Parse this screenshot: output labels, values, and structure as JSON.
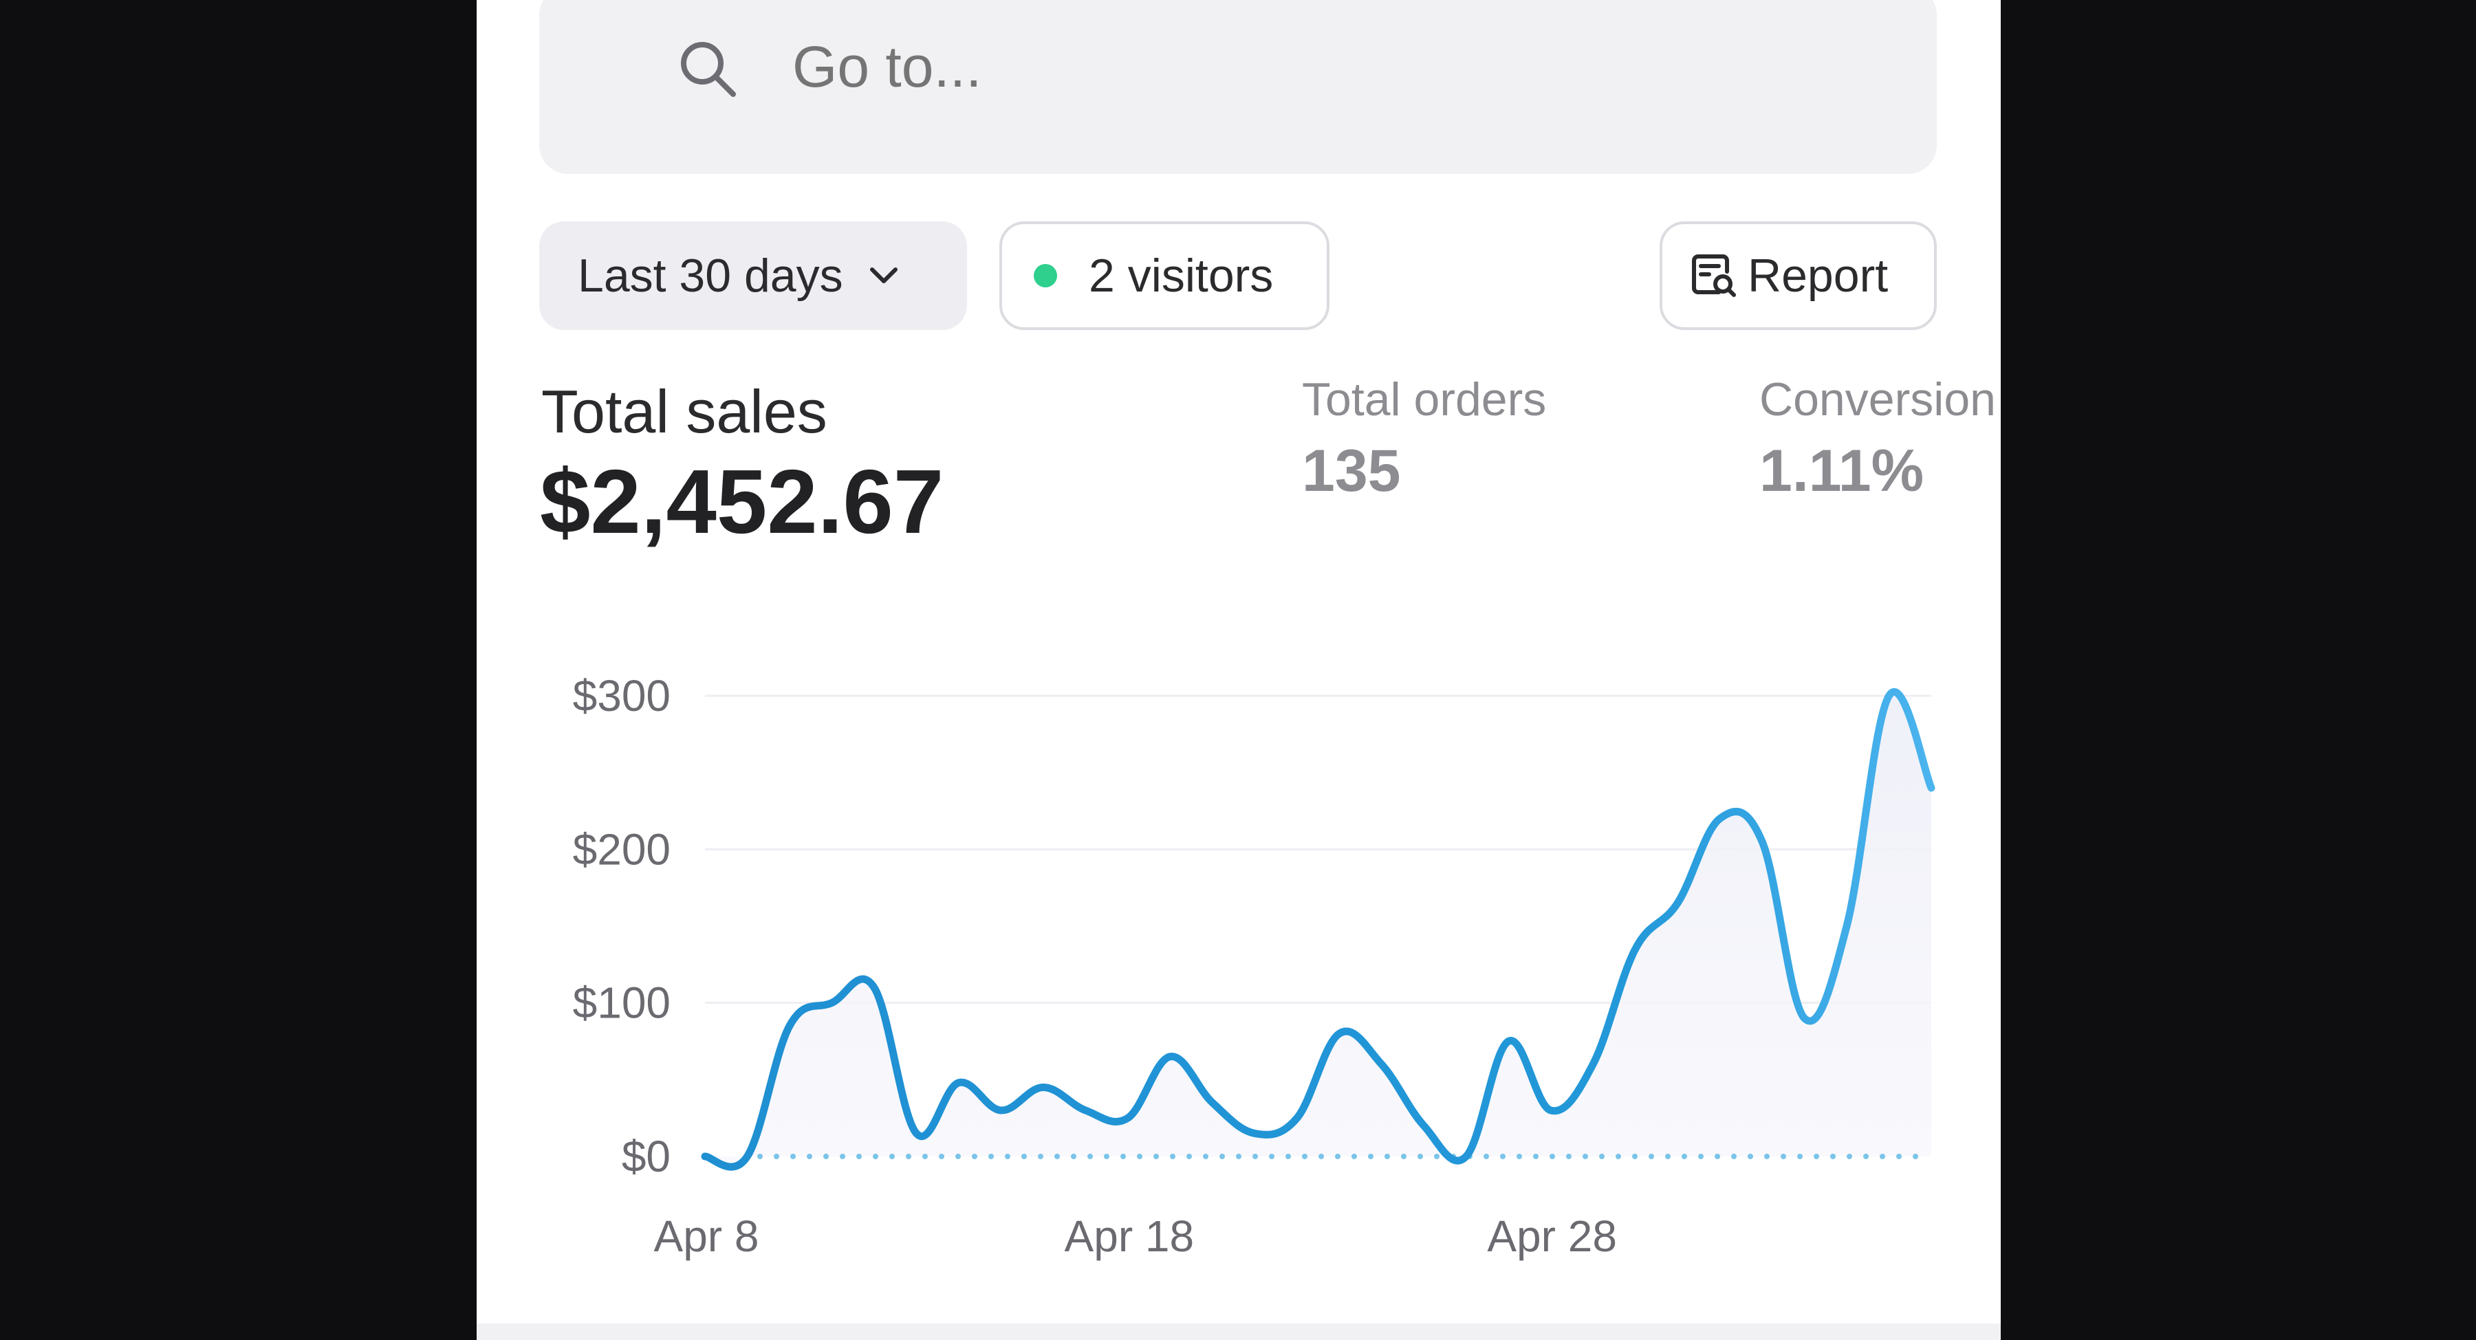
{
  "search": {
    "placeholder": "Go to..."
  },
  "filters": {
    "date_range_label": "Last 30 days",
    "visitors_label": "2 visitors",
    "report_label": "Report"
  },
  "metrics": {
    "total_sales": {
      "label": "Total sales",
      "value": "$2,452.67"
    },
    "total_orders": {
      "label": "Total orders",
      "value": "135"
    },
    "conversion": {
      "label": "Conversion",
      "value": "1.11%"
    }
  },
  "colors": {
    "accent": "#2296d8",
    "live": "#2fcf8e",
    "comparison": "#7ac4ea"
  },
  "icons": {
    "search": "search-icon",
    "date_dropdown": "chevron-down-icon",
    "report": "report-icon"
  },
  "chart_data": {
    "type": "line",
    "title": "",
    "xlabel": "",
    "ylabel": "",
    "ylim": [
      0,
      300
    ],
    "y_ticks": [
      "$0",
      "$100",
      "$200",
      "$300"
    ],
    "x_ticks": [
      "Apr 8",
      "Apr 18",
      "Apr 28"
    ],
    "grid": true,
    "series": [
      {
        "x": [
          "Apr 8",
          "Apr 9",
          "Apr 10",
          "Apr 11",
          "Apr 12",
          "Apr 13",
          "Apr 14",
          "Apr 15",
          "Apr 16",
          "Apr 17",
          "Apr 18",
          "Apr 19",
          "Apr 20",
          "Apr 21",
          "Apr 22",
          "Apr 23",
          "Apr 24",
          "Apr 25",
          "Apr 26",
          "Apr 27",
          "Apr 28",
          "Apr 29",
          "Apr 30",
          "May 1",
          "May 2",
          "May 3",
          "May 4",
          "May 5",
          "May 6",
          "May 7"
        ],
        "values": [
          0,
          0,
          85,
          100,
          110,
          15,
          48,
          30,
          45,
          30,
          25,
          65,
          35,
          15,
          25,
          80,
          60,
          20,
          0,
          75,
          30,
          60,
          135,
          165,
          220,
          205,
          90,
          150,
          300,
          240
        ]
      },
      {
        "x": [
          "Apr 8",
          "Apr 9",
          "Apr 10",
          "Apr 11",
          "Apr 12",
          "Apr 13",
          "Apr 14",
          "Apr 15",
          "Apr 16",
          "Apr 17",
          "Apr 18",
          "Apr 19",
          "Apr 20",
          "Apr 21",
          "Apr 22",
          "Apr 23",
          "Apr 24",
          "Apr 25",
          "Apr 26",
          "Apr 27",
          "Apr 28",
          "Apr 29",
          "Apr 30",
          "May 1",
          "May 2",
          "May 3",
          "May 4",
          "May 5",
          "May 6",
          "May 7"
        ],
        "values": [
          0,
          0,
          0,
          0,
          0,
          0,
          0,
          0,
          0,
          0,
          0,
          0,
          0,
          0,
          0,
          0,
          0,
          0,
          0,
          0,
          0,
          0,
          0,
          0,
          0,
          0,
          0,
          0,
          0,
          0
        ]
      }
    ]
  }
}
